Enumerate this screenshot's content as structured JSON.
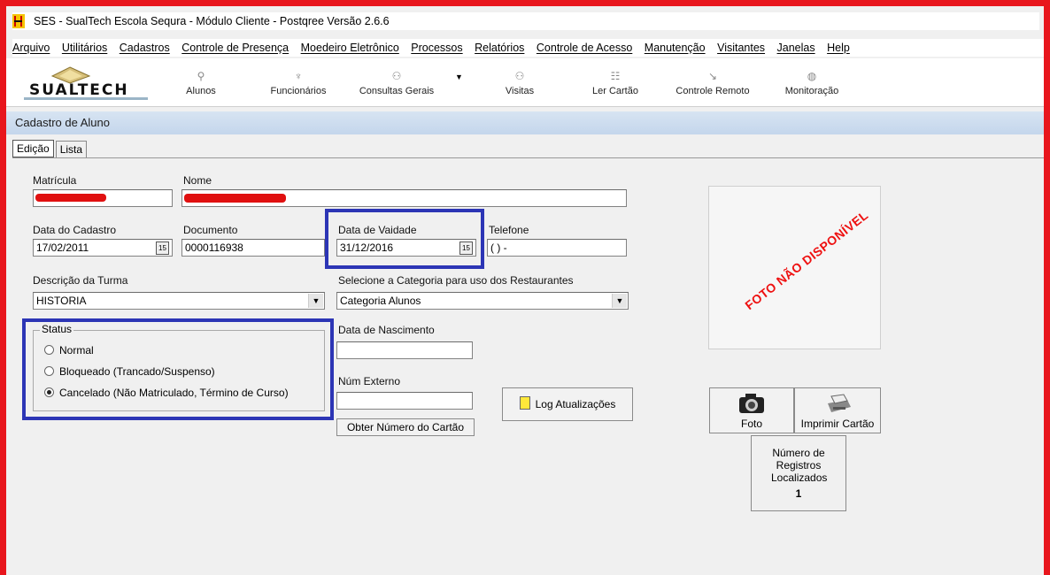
{
  "window": {
    "title": "SES - SualTech Escola Sequra - Módulo Cliente - Postqree Versão 2.6.6"
  },
  "menu": [
    "Arquivo",
    "Utilitários",
    "Cadastros",
    "Controle de Presença",
    "Moedeiro Eletrônico",
    "Processos",
    "Relatórios",
    "Controle de Acesso",
    "Manutenção",
    "Visitantes",
    "Janelas",
    "Help"
  ],
  "toolbar": {
    "logo_text": "SUALTECH",
    "items": [
      {
        "label": "Alunos",
        "icon": "student-icon"
      },
      {
        "label": "Funcionários",
        "icon": "employee-icon"
      },
      {
        "label": "Consultas Gerais",
        "icon": "query-icon"
      },
      {
        "label": "Visitas",
        "icon": "visits-icon"
      },
      {
        "label": "Ler Cartão",
        "icon": "card-reader-icon"
      },
      {
        "label": "Controle Remoto",
        "icon": "remote-control-icon"
      },
      {
        "label": "Monitoração",
        "icon": "monitor-icon"
      }
    ]
  },
  "form": {
    "title": "Cadastro de Aluno",
    "tabs": [
      "Edição",
      "Lista"
    ],
    "matricula_label": "Matrícula",
    "nome_label": "Nome",
    "data_cadastro_label": "Data do Cadastro",
    "data_cadastro_value": "17/02/2011",
    "documento_label": "Documento",
    "documento_value": "0000116938",
    "data_validade_label": "Data de Vaidade",
    "data_validade_value": "31/12/2016",
    "telefone_label": "Telefone",
    "telefone_value": "( )  -",
    "turma_label": "Descrição da Turma",
    "turma_value": "HISTORIA",
    "categoria_label": "Selecione a Categoria para uso dos Restaurantes",
    "categoria_value": "Categoria Alunos",
    "status_label": "Status",
    "status_options": [
      "Normal",
      "Bloqueado (Trancado/Suspenso)",
      "Cancelado (Não Matriculado, Término de Curso)"
    ],
    "status_selected": "Cancelado (Não Matriculado, Término de Curso)",
    "nascimento_label": "Data de Nascimento",
    "externo_label": "Núm Externo",
    "obter_cartao_button": "Obter Número do Cartão",
    "log_button": "Log Atualizações",
    "photo_placeholder": "FOTO NÃO DISPONÍVEL",
    "foto_button": "Foto",
    "imprimir_button": "Imprimir Cartão",
    "registros_label": "Número de Registros Localizados",
    "registros_value": "1"
  },
  "colors": {
    "frame": "#e8161d",
    "highlight": "#2c35b5",
    "redaction": "#e01010"
  }
}
